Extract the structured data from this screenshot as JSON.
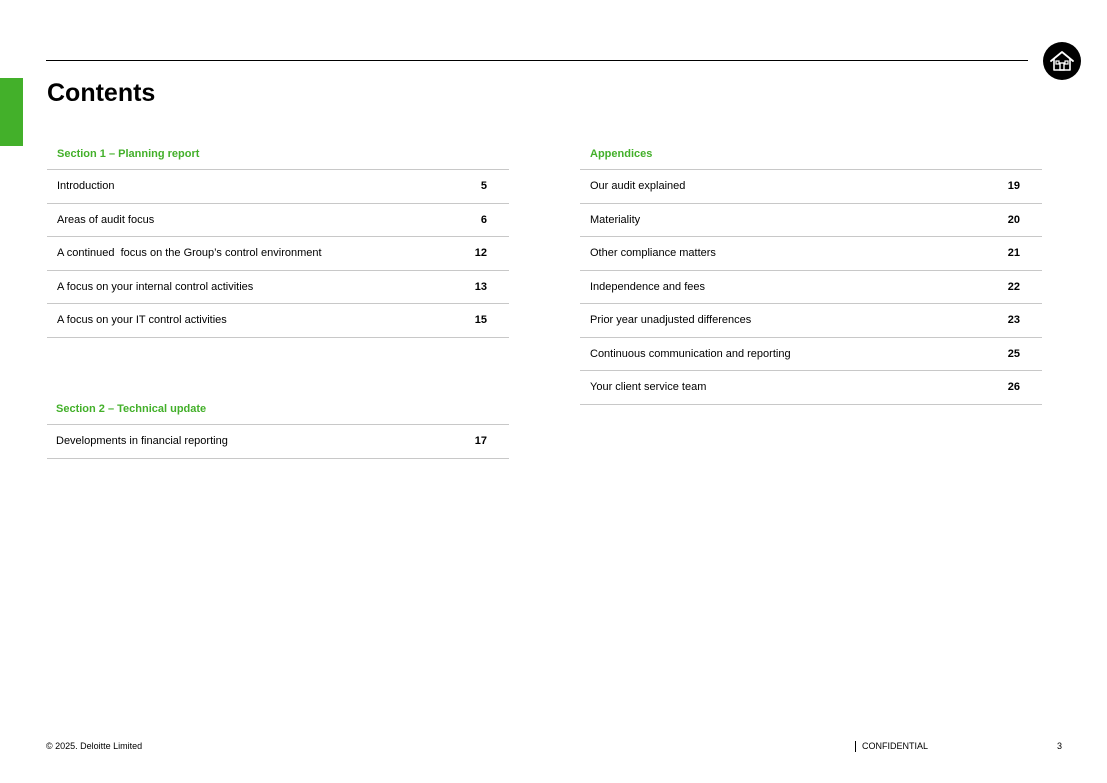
{
  "header": {
    "title": "Contents",
    "home_icon": "home-icon",
    "accent_color": "#43b02a"
  },
  "left_column": {
    "section1": {
      "heading": "Section 1 – Planning report",
      "items": [
        {
          "label": "Introduction",
          "page": "5"
        },
        {
          "label": "Areas of audit focus",
          "page": "6"
        },
        {
          "label": "A continued  focus on the Group’s control environment",
          "page": "12"
        },
        {
          "label": "A focus on your internal control activities",
          "page": "13"
        },
        {
          "label": "A focus on your IT control activities",
          "page": "15"
        }
      ]
    },
    "section2": {
      "heading": "Section 2 – Technical update",
      "items": [
        {
          "label": "Developments in financial reporting",
          "page": "17"
        }
      ]
    }
  },
  "right_column": {
    "appendices": {
      "heading": "Appendices",
      "items": [
        {
          "label": "Our audit explained",
          "page": "19"
        },
        {
          "label": "Materiality",
          "page": "20"
        },
        {
          "label": "Other compliance matters",
          "page": "21"
        },
        {
          "label": "Independence and fees",
          "page": "22"
        },
        {
          "label": "Prior year unadjusted differences",
          "page": "23"
        },
        {
          "label": "Continuous communication and reporting",
          "page": "25"
        },
        {
          "label": "Your client service team",
          "page": "26"
        }
      ]
    }
  },
  "footer": {
    "copyright": "© 2025. Deloitte Limited",
    "classification": "CONFIDENTIAL",
    "page_number": "3"
  }
}
